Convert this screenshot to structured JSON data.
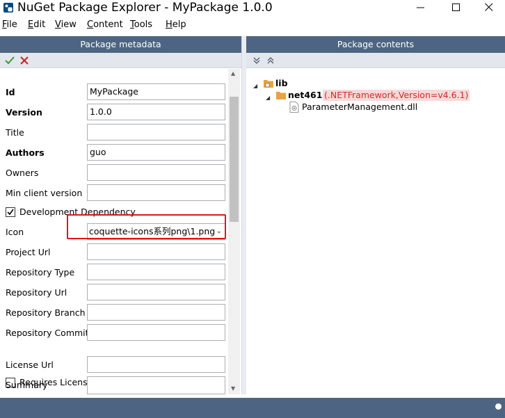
{
  "window": {
    "title": "NuGet Package Explorer - MyPackage 1.0.0"
  },
  "menu": {
    "items": [
      {
        "label": "File",
        "accel": "F",
        "rest": "ile"
      },
      {
        "label": "Edit",
        "accel": "E",
        "rest": "dit"
      },
      {
        "label": "View",
        "accel": "V",
        "rest": "iew"
      },
      {
        "label": "Content",
        "accel": "C",
        "rest": "ontent"
      },
      {
        "label": "Tools",
        "accel": "T",
        "rest": "ools"
      },
      {
        "label": "Help",
        "accel": "H",
        "rest": "elp"
      }
    ]
  },
  "metadata_panel": {
    "header": "Package metadata",
    "fields": {
      "id": {
        "label": "Id",
        "value": "MyPackage"
      },
      "version": {
        "label": "Version",
        "value": "1.0.0"
      },
      "title": {
        "label": "Title",
        "value": ""
      },
      "authors": {
        "label": "Authors",
        "value": "guo"
      },
      "owners": {
        "label": "Owners",
        "value": ""
      },
      "min_client_version": {
        "label": "Min client version",
        "value": ""
      },
      "icon": {
        "label": "Icon",
        "value": "coquette-icons系列png\\1.png"
      },
      "project_url": {
        "label": "Project Url",
        "value": ""
      },
      "repository_type": {
        "label": "Repository Type",
        "value": ""
      },
      "repository_url": {
        "label": "Repository Url",
        "value": ""
      },
      "repository_branch": {
        "label": "Repository Branch",
        "value": ""
      },
      "repository_commit": {
        "label": "Repository Commit",
        "value": ""
      },
      "license_url": {
        "label": "License Url",
        "value": ""
      },
      "summary": {
        "label": "Summary",
        "value": ""
      }
    },
    "checkboxes": {
      "development_dependency": {
        "label": "Development Dependency",
        "checked": true
      },
      "requires_license_acceptance": {
        "label": "Requires License Acceptance",
        "checked": false
      }
    }
  },
  "contents_panel": {
    "header": "Package contents",
    "tree": {
      "root": "lib",
      "framework_folder": "net461",
      "framework_label": "(.NETFramework,Version=v4.6.1)",
      "file": "ParameterManagement.dll"
    }
  },
  "colors": {
    "header_bg": "#4d6582",
    "highlight_border": "#e0141b",
    "framework_text": "#d12a2a",
    "folder": "#e8a33c"
  },
  "icons": [
    "nuget-app-icon",
    "minimize-icon",
    "maximize-icon",
    "close-icon",
    "check-icon",
    "cancel-icon",
    "collapse-all-icon",
    "expand-all-icon",
    "folder-icon",
    "dll-file-icon"
  ]
}
